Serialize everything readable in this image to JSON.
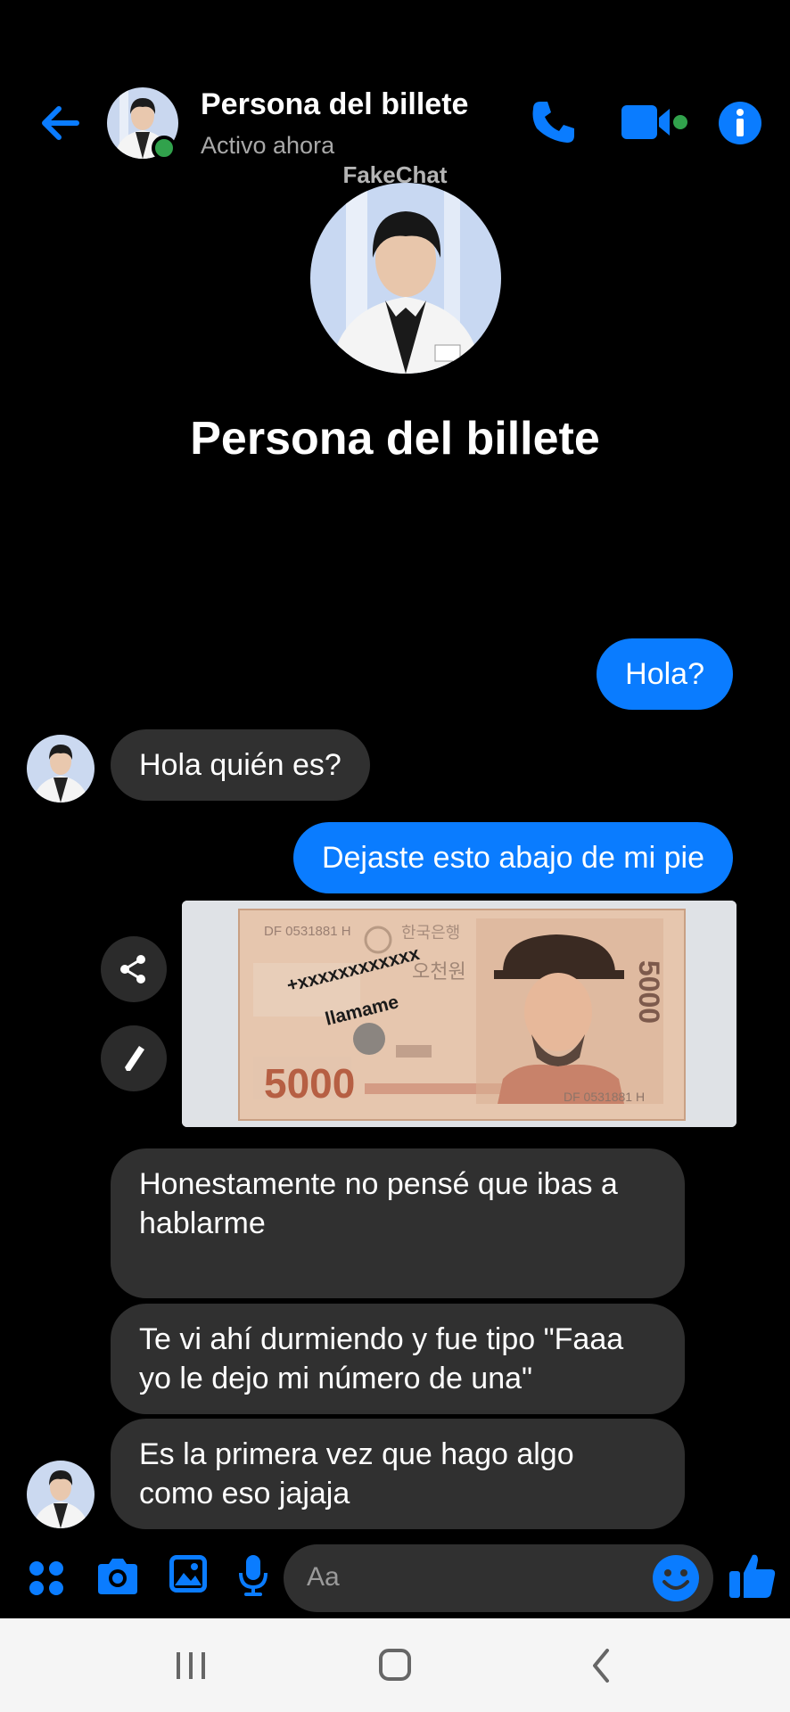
{
  "header": {
    "contact_name": "Persona del billete",
    "status": "Activo ahora",
    "back_icon": "arrow-left-icon",
    "call_icon": "phone-icon",
    "video_icon": "video-camera-icon",
    "info_icon": "info-icon"
  },
  "watermark": "FakeChat",
  "profile": {
    "name": "Persona del billete"
  },
  "messages": [
    {
      "direction": "out",
      "text": "Hola?"
    },
    {
      "direction": "in",
      "text": "Hola quién es?"
    },
    {
      "direction": "out",
      "text": "Dejaste esto abajo de mi pie"
    },
    {
      "direction": "out",
      "type": "image",
      "text_on_image": [
        "+xxxxxxxxxxxx",
        "llamame"
      ],
      "banknote": {
        "denomination": "5000",
        "serial": "DF 0531881 H",
        "korean_text": [
          "한국은행",
          "오천원"
        ]
      }
    },
    {
      "direction": "in",
      "text": "Honestamente no pensé que ibas a hablarme"
    },
    {
      "direction": "in",
      "text": "Te vi ahí durmiendo y fue tipo \"Faaa yo le dejo mi número de una\""
    },
    {
      "direction": "in",
      "text": "Es la primera vez que hago algo como eso jajaja"
    }
  ],
  "image_actions": {
    "share_icon": "share-icon",
    "edit_icon": "pencil-icon"
  },
  "composer": {
    "placeholder": "Aa",
    "icons": [
      "apps-grid-icon",
      "camera-icon",
      "gallery-icon",
      "microphone-icon",
      "emoji-icon",
      "thumbs-up-icon"
    ]
  },
  "navbar": {
    "icons": [
      "recent-apps-icon",
      "home-icon",
      "back-icon"
    ]
  },
  "colors": {
    "accent": "#0a7cff",
    "incoming_bubble": "#303030",
    "online": "#31a24c",
    "background": "#000000"
  }
}
